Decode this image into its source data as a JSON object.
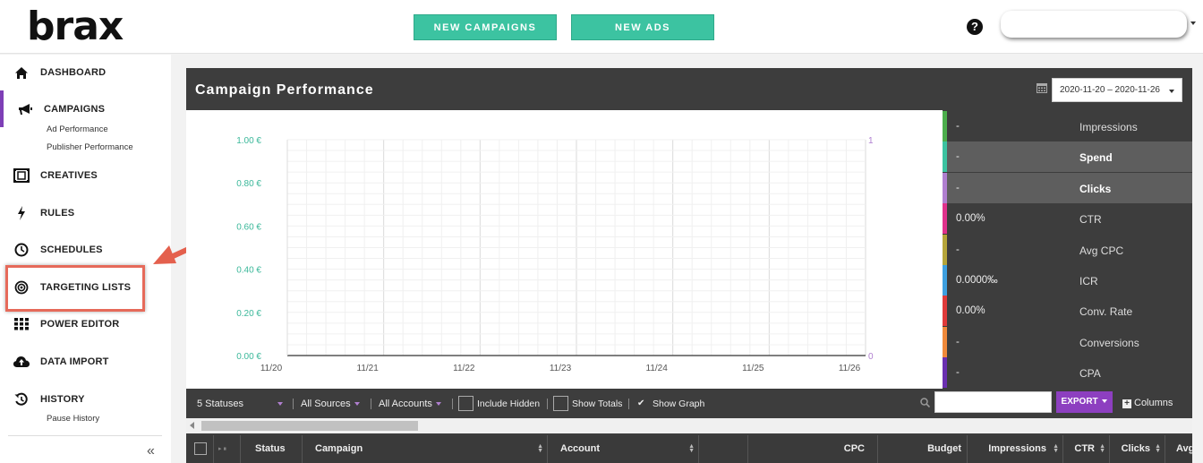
{
  "header": {
    "logo": "brax",
    "new_campaigns_label": "NEW CAMPAIGNS",
    "new_ads_label": "NEW ADS",
    "help_glyph": "?"
  },
  "sidebar": {
    "items": [
      {
        "label": "DASHBOARD",
        "icon": "home-icon"
      },
      {
        "label": "CAMPAIGNS",
        "icon": "megaphone-icon",
        "active": true,
        "subitems": [
          "Ad Performance",
          "Publisher Performance"
        ]
      },
      {
        "label": "CREATIVES",
        "icon": "creatives-icon"
      },
      {
        "label": "RULES",
        "icon": "bolt-icon"
      },
      {
        "label": "SCHEDULES",
        "icon": "clock-icon"
      },
      {
        "label": "TARGETING LISTS",
        "icon": "target-icon",
        "highlighted": true
      },
      {
        "label": "POWER EDITOR",
        "icon": "grid-icon"
      },
      {
        "label": "DATA IMPORT",
        "icon": "cloud-upload-icon"
      },
      {
        "label": "HISTORY",
        "icon": "history-icon",
        "subitems": [
          "Pause History"
        ]
      }
    ],
    "collapse_glyph": "«"
  },
  "panel": {
    "title": "Campaign Performance",
    "date_range": "2020-11-20 – 2020-11-26"
  },
  "chart_data": {
    "type": "line",
    "x": [
      "11/20",
      "11/21",
      "11/22",
      "11/23",
      "11/24",
      "11/25",
      "11/26"
    ],
    "y_left_ticks": [
      "0.00 €",
      "0.20 €",
      "0.40 €",
      "0.60 €",
      "0.80 €",
      "1.00 €"
    ],
    "y_left_range": [
      0,
      1
    ],
    "y_right_ticks": [
      "0",
      "1"
    ],
    "y_right_range": [
      0,
      1
    ],
    "grid": true,
    "series": [],
    "colors": {
      "left_axis": "#3bb89a",
      "right_axis": "#b07fd0"
    }
  },
  "metrics": [
    {
      "value": "-",
      "name": "Impressions",
      "color": "#4cae4c",
      "selected": false
    },
    {
      "value": "-",
      "name": "Spend",
      "color": "#3cc3a1",
      "selected": true
    },
    {
      "value": "-",
      "name": "Clicks",
      "color": "#b07fd0",
      "selected": true
    },
    {
      "value": "0.00%",
      "name": "CTR",
      "color": "#e0328c",
      "selected": false
    },
    {
      "value": "-",
      "name": "Avg CPC",
      "color": "#b5a53a",
      "selected": false
    },
    {
      "value": "0.0000‰",
      "name": "ICR",
      "color": "#3ea0e0",
      "selected": false
    },
    {
      "value": "0.00%",
      "name": "Conv. Rate",
      "color": "#e03a3a",
      "selected": false
    },
    {
      "value": "-",
      "name": "Conversions",
      "color": "#f0893a",
      "selected": false
    },
    {
      "value": "-",
      "name": "CPA",
      "color": "#6a2fb0",
      "selected": false
    }
  ],
  "filters": {
    "statuses": "5 Statuses",
    "sources": "All Sources",
    "accounts": "All Accounts",
    "include_hidden": "Include Hidden",
    "show_totals": "Show Totals",
    "show_graph": "Show Graph",
    "show_graph_check": "✔",
    "export_label": "EXPORT",
    "columns_label": "Columns",
    "columns_plus": "+"
  },
  "table": {
    "headers": [
      "Status",
      "Campaign",
      "Account",
      "CPC",
      "Budget",
      "Impressions",
      "CTR",
      "Clicks",
      "Avg"
    ]
  }
}
